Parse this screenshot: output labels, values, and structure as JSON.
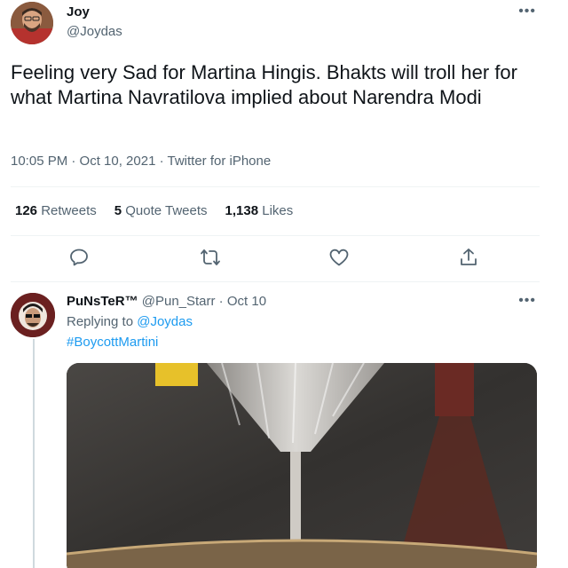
{
  "tweet": {
    "display_name": "Joy",
    "handle": "@Joydas",
    "more_label": "•••",
    "text": "Feeling very Sad for Martina Hingis. Bhakts will troll her for what Martina Navratilova implied about Narendra Modi",
    "meta": "10:05 PM · Oct 10, 2021 · Twitter for iPhone",
    "stats": {
      "retweets_count": "126",
      "retweets_label": "Retweets",
      "quotes_count": "5",
      "quotes_label": "Quote Tweets",
      "likes_count": "1,138",
      "likes_label": "Likes"
    },
    "actions": [
      "reply-icon",
      "retweet-icon",
      "like-icon",
      "share-icon"
    ]
  },
  "reply": {
    "display_name": "PuNsTeR™",
    "handle_time": "@Pun_Starr · Oct 10",
    "more_label": "•••",
    "replying_prefix": "Replying to",
    "replying_to": "@Joydas",
    "hashtag": "#BoycottMartini",
    "media_icon": "martini-photo"
  },
  "colors": {
    "accent": "#1d9bf0",
    "secondary_text": "#536471",
    "primary_text": "#0f1419",
    "divider": "#eff3f4"
  }
}
